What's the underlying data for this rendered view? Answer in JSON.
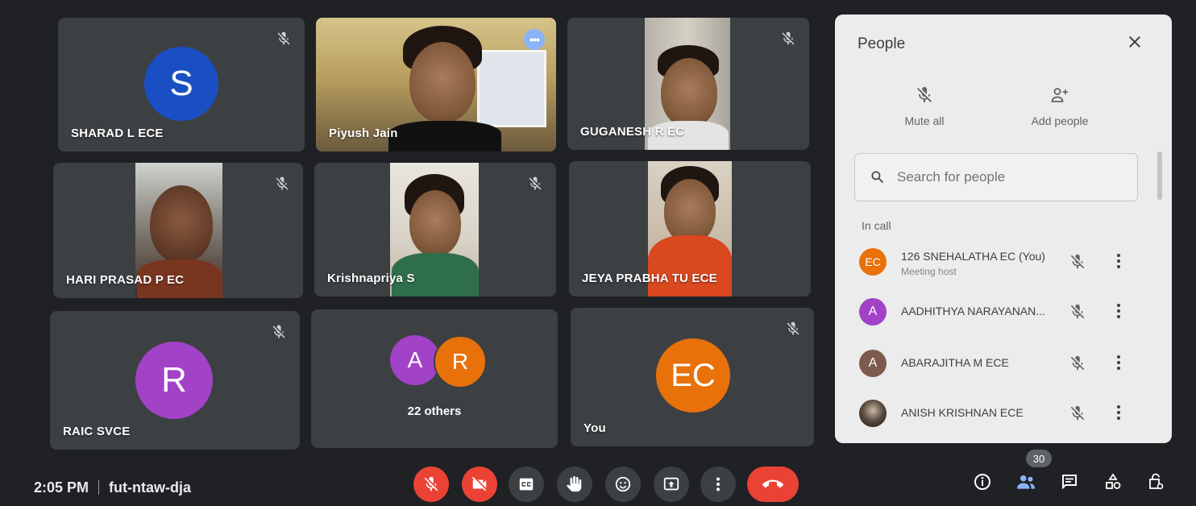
{
  "meeting": {
    "time": "2:05 PM",
    "code": "fut-ntaw-dja"
  },
  "tiles": [
    {
      "name": "SHARAD L ECE",
      "initial": "S",
      "color": "#1a4fc4",
      "muted": true
    },
    {
      "name": "Piyush Jain",
      "video": true,
      "active": true
    },
    {
      "name": "GUGANESH R EC",
      "video": true,
      "muted": true
    },
    {
      "name": "HARI PRASAD P EC",
      "video": true,
      "muted": true
    },
    {
      "name": "Krishnapriya S",
      "video": true,
      "muted": true
    },
    {
      "name": "JEYA PRABHA TU ECE",
      "video": true
    },
    {
      "name": "RAIC SVCE",
      "initial": "R",
      "color": "#a142c7",
      "muted": true
    },
    {
      "name": "22 others",
      "initials": [
        "A",
        "R"
      ],
      "colors": [
        "#a142c7",
        "#e8710a"
      ]
    },
    {
      "name": "You",
      "initial": "EC",
      "color": "#e8710a",
      "muted": true
    }
  ],
  "panel": {
    "title": "People",
    "mute_all": "Mute all",
    "add_people": "Add people",
    "search_placeholder": "Search for people",
    "section": "In call",
    "participants": [
      {
        "name": "126 SNEHALATHA EC (You)",
        "sub": "Meeting host",
        "initial": "EC",
        "color": "#e8710a"
      },
      {
        "name": "AADHITHYA NARAYANAN...",
        "initial": "A",
        "color": "#a142c7"
      },
      {
        "name": "ABARAJITHA M ECE",
        "initial": "A",
        "color": "#7d5a4d"
      },
      {
        "name": "ANISH KRISHNAN ECE",
        "initial": "",
        "color": "#3a3a3a"
      }
    ]
  },
  "toolbar": {
    "people_count": "30"
  }
}
